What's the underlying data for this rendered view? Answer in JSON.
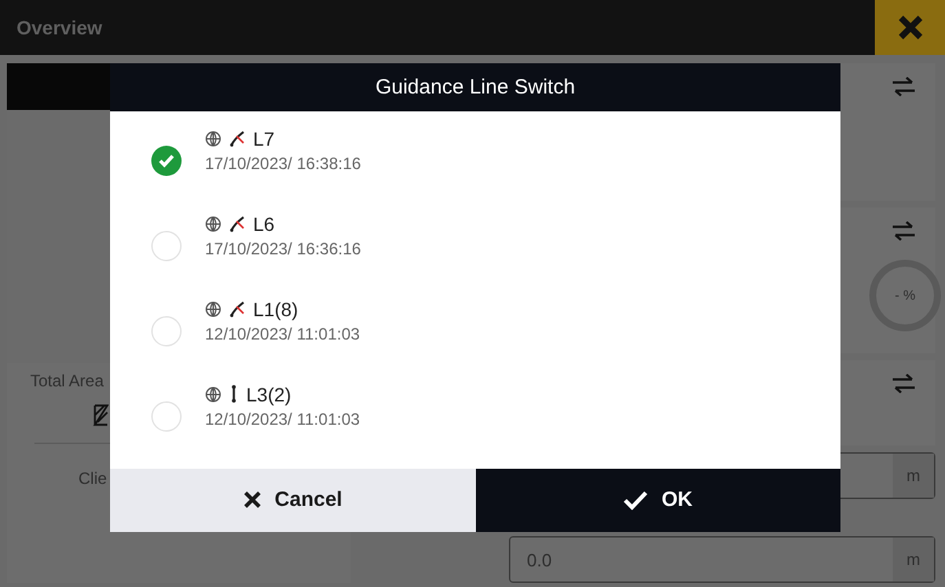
{
  "topbar": {
    "title": "Overview"
  },
  "background": {
    "total_area_label": "Total Area",
    "client_label": "Clie",
    "progress": "- %",
    "fields": [
      {
        "unit": "m"
      },
      {
        "value": "0.0",
        "unit": "m"
      }
    ]
  },
  "dialog": {
    "title": "Guidance Line Switch",
    "lines": [
      {
        "name": "L7",
        "kind": "curve",
        "date": "17/10/2023/ 16:38:16",
        "selected": true
      },
      {
        "name": "L6",
        "kind": "curve",
        "date": "17/10/2023/ 16:36:16",
        "selected": false
      },
      {
        "name": "L1(8)",
        "kind": "curve",
        "date": "12/10/2023/ 11:01:03",
        "selected": false
      },
      {
        "name": "L3(2)",
        "kind": "straight",
        "date": "12/10/2023/ 11:01:03",
        "selected": false
      }
    ],
    "buttons": [
      {
        "kind": "cancel",
        "label": "Cancel"
      },
      {
        "kind": "ok",
        "label": "OK"
      }
    ]
  }
}
